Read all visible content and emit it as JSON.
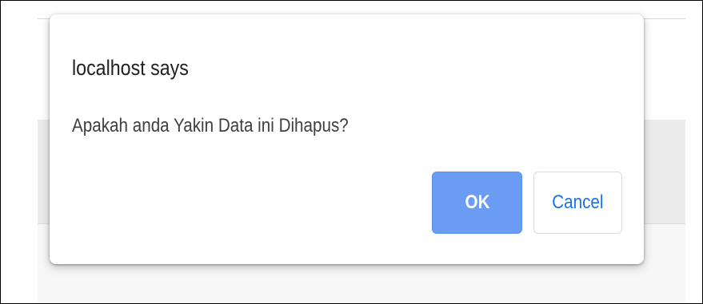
{
  "dialog": {
    "title": "localhost says",
    "message": "Apakah anda Yakin Data ini Dihapus?",
    "ok_label": "OK",
    "cancel_label": "Cancel"
  },
  "colors": {
    "ok_background": "#6b9cf3",
    "cancel_text": "#1a73e8",
    "backdrop_band": "#ececec"
  }
}
